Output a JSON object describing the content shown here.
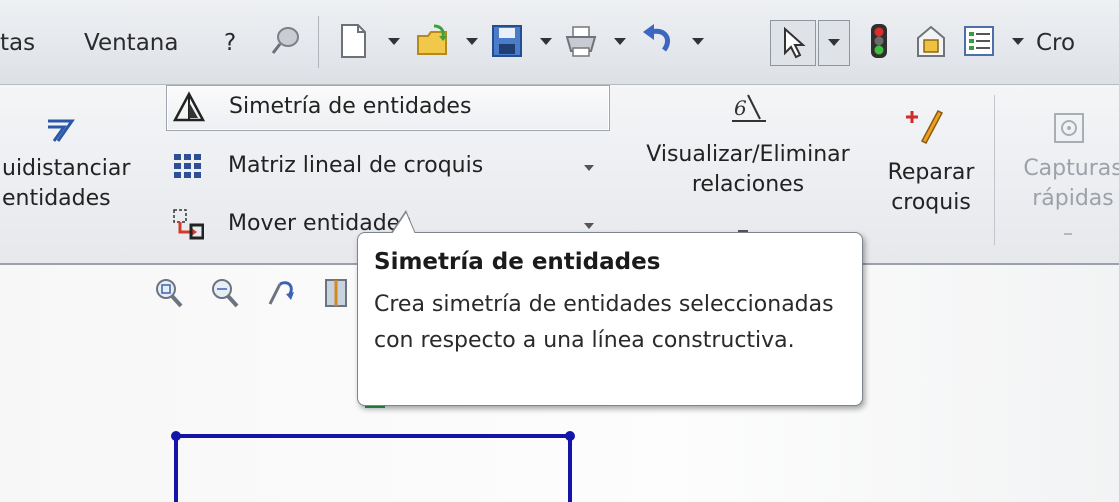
{
  "menubar": {
    "items": [
      "tas",
      "Ventana",
      "?"
    ],
    "right_label": "Cro"
  },
  "ribbon": {
    "equidistance": {
      "line1": "uidistanciar",
      "line2": "entidades"
    },
    "commands": [
      {
        "label": "Simetría de entidades",
        "icon": "mirror-entities-icon"
      },
      {
        "label": "Matriz lineal de croquis",
        "icon": "linear-pattern-icon"
      },
      {
        "label": "Mover entidades",
        "icon": "move-entities-icon"
      }
    ],
    "relations": {
      "line1": "Visualizar/Eliminar",
      "line2": "relaciones"
    },
    "repair": {
      "line1": "Reparar",
      "line2": "croquis"
    },
    "quick_snaps": {
      "line1": "Capturas",
      "line2": "rápidas"
    }
  },
  "tooltip": {
    "title": "Simetría de entidades",
    "body": "Crea simetría de entidades seleccionadas con respecto a una línea constructiva."
  },
  "colors": {
    "sketch_line": "#1414a8",
    "sketch_point": "#1d8f3a"
  }
}
